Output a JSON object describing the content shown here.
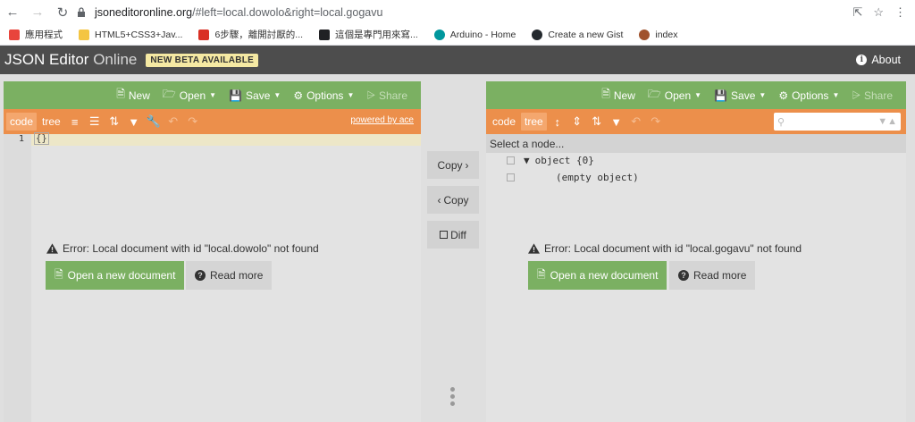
{
  "browser": {
    "url_host": "jsoneditoronline.org",
    "url_path": "/#left=local.dowolo&right=local.gogavu",
    "bookmarks": [
      {
        "label": "應用程式",
        "icon": "apps-grid-icon",
        "color": "#e8453c"
      },
      {
        "label": "HTML5+CSS3+Jav...",
        "icon": "folder-icon",
        "color": "#f4c542"
      },
      {
        "label": "6步驟，離開討厭的...",
        "icon": "site-icon",
        "color": "#d93025"
      },
      {
        "label": "這個是專門用來寫...",
        "icon": "site-icon",
        "color": "#202124"
      },
      {
        "label": "Arduino - Home",
        "icon": "arduino-icon",
        "color": "#00979d"
      },
      {
        "label": "Create a new Gist",
        "icon": "github-icon",
        "color": "#24292e"
      },
      {
        "label": "index",
        "icon": "avatar-icon",
        "color": "#a0522d"
      }
    ]
  },
  "header": {
    "title_main": "JSON Editor",
    "title_light": " Online",
    "beta": "NEW BETA AVAILABLE",
    "about": "About"
  },
  "left": {
    "menu": {
      "new": "New",
      "open": "Open",
      "save": "Save",
      "options": "Options",
      "share": "Share"
    },
    "mode_code": "code",
    "mode_tree": "tree",
    "powered": "powered by ace",
    "line_number": "1",
    "code": "{}",
    "error": "Error: Local document with id \"local.dowolo\" not found",
    "open_doc": "Open a new document",
    "read_more": "Read more"
  },
  "middle": {
    "copy_right": "Copy",
    "copy_left": "Copy",
    "diff": "Diff"
  },
  "right": {
    "menu": {
      "new": "New",
      "open": "Open",
      "save": "Save",
      "options": "Options",
      "share": "Share"
    },
    "mode_code": "code",
    "mode_tree": "tree",
    "nav": "Select a node...",
    "tree_root": "object {0}",
    "tree_empty": "(empty object)",
    "error": "Error: Local document with id \"local.gogavu\" not found",
    "open_doc": "Open a new document",
    "read_more": "Read more"
  },
  "colors": {
    "menubar": "#7bb062",
    "toolbar": "#ec8f4b",
    "appbar": "#4d4d4d"
  }
}
